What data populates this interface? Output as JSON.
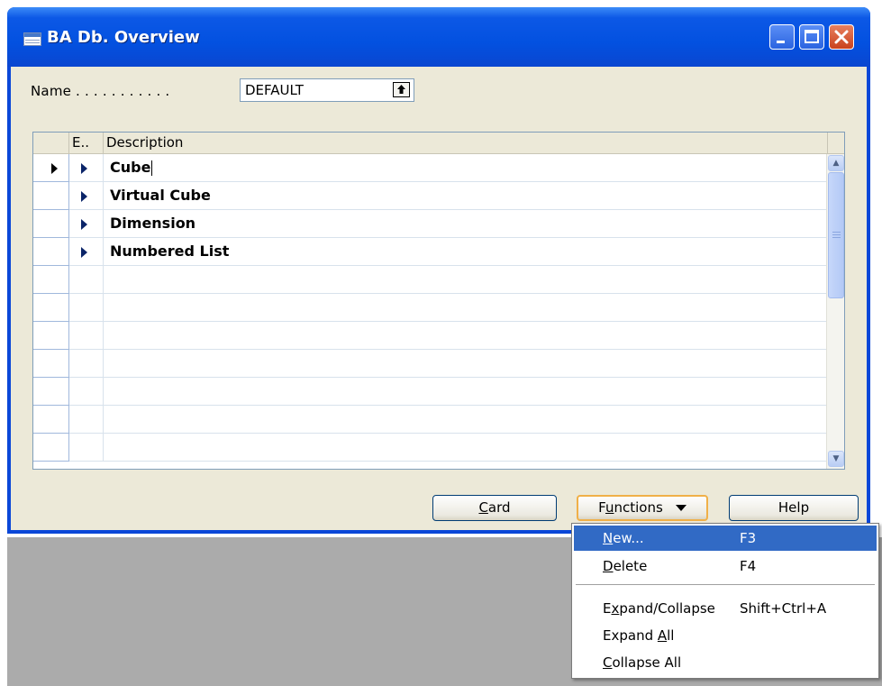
{
  "window": {
    "title": "BA Db. Overview"
  },
  "form": {
    "name_label": "Name . . . . . . . . . . .",
    "name_value": "DEFAULT"
  },
  "grid": {
    "columns": [
      "E..",
      "Description"
    ],
    "rows": [
      {
        "expander": true,
        "description": "Cube",
        "current": true
      },
      {
        "expander": true,
        "description": "Virtual Cube",
        "current": false
      },
      {
        "expander": true,
        "description": "Dimension",
        "current": false
      },
      {
        "expander": true,
        "description": "Numbered List",
        "current": false
      },
      {
        "expander": false,
        "description": "",
        "current": false
      },
      {
        "expander": false,
        "description": "",
        "current": false
      },
      {
        "expander": false,
        "description": "",
        "current": false
      },
      {
        "expander": false,
        "description": "",
        "current": false
      },
      {
        "expander": false,
        "description": "",
        "current": false
      },
      {
        "expander": false,
        "description": "",
        "current": false
      },
      {
        "expander": false,
        "description": "",
        "current": false
      }
    ]
  },
  "buttons": {
    "card": {
      "pre": "",
      "mn": "C",
      "post": "ard"
    },
    "functions": {
      "pre": "F",
      "mn": "u",
      "post": "nctions"
    },
    "help": "Help"
  },
  "functions_menu": {
    "items": [
      {
        "pre": "",
        "mn": "N",
        "post": "ew...",
        "shortcut": "F3",
        "highlighted": true
      },
      {
        "pre": "",
        "mn": "D",
        "post": "elete",
        "shortcut": "F4",
        "highlighted": false
      },
      {
        "pre": "E",
        "mn": "x",
        "post": "pand/Collapse",
        "shortcut": "Shift+Ctrl+A",
        "highlighted": false
      },
      {
        "pre": "Expand ",
        "mn": "A",
        "post": "ll",
        "shortcut": "",
        "highlighted": false
      },
      {
        "pre": "",
        "mn": "C",
        "post": "ollapse All",
        "shortcut": "",
        "highlighted": false
      }
    ]
  },
  "icons": {
    "title": "table-icon",
    "minimize": "minimize-icon",
    "maximize": "maximize-icon",
    "close": "close-icon",
    "lookup": "lookup-arrow-icon",
    "expander": "expand-triangle-icon"
  },
  "colors": {
    "titlebar": "#0351e0",
    "client": "#ece9d8",
    "menu_highlight": "#316ac5",
    "close_button": "#c9421d"
  }
}
